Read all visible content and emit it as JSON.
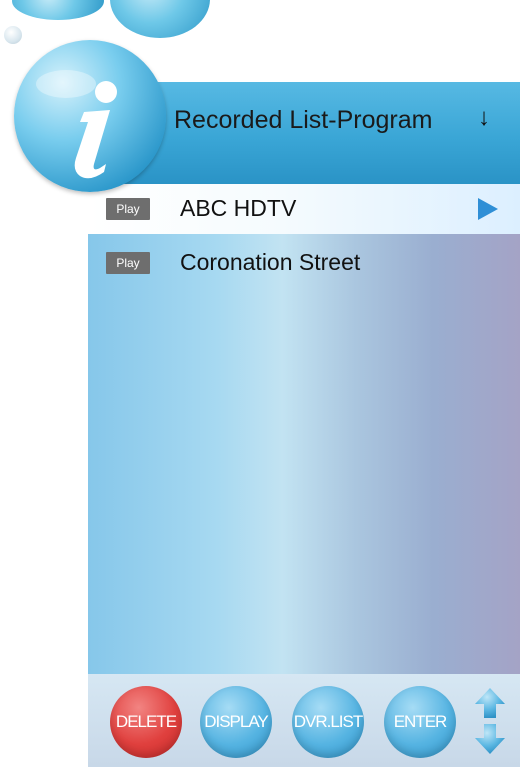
{
  "header": {
    "title": "Recorded List-Program",
    "sort_icon": "sort-down-arrow-icon",
    "sort_glyph": "↓"
  },
  "info_icon": "info-icon",
  "list": {
    "items": [
      {
        "badge": "Play",
        "label": "ABC HDTV",
        "selected": true
      },
      {
        "badge": "Play",
        "label": "Coronation Street",
        "selected": false
      }
    ]
  },
  "buttons": {
    "delete_label": "DELETE",
    "display_label": "DISPLAY",
    "dvrlist_label": "DVR.LIST",
    "enter_label": "ENTER"
  },
  "colors": {
    "header_blue": "#3aa6d6",
    "delete_red": "#e0403e",
    "button_blue": "#56b4e2",
    "selected_arrow": "#2f8fd6"
  }
}
